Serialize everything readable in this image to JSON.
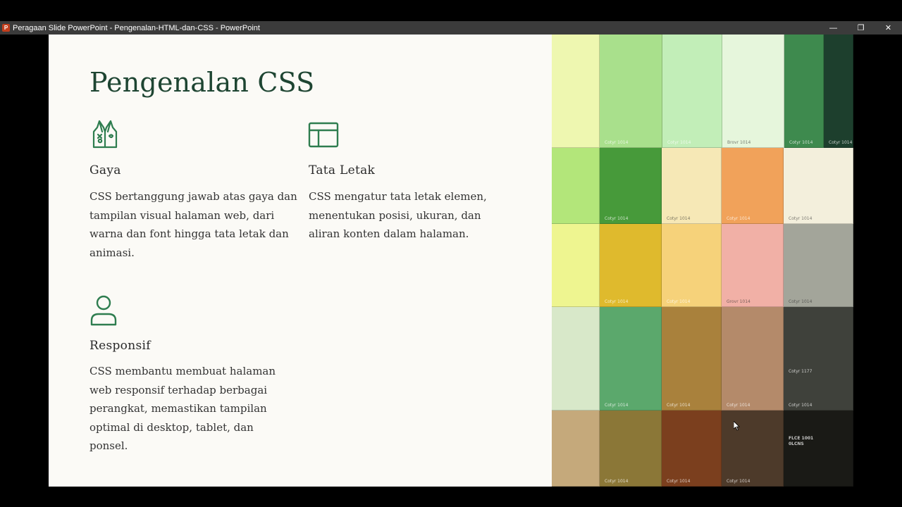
{
  "window": {
    "title": "Peragaan Slide PowerPoint  -  Pengenalan-HTML-dan-CSS - PowerPoint",
    "app_icon": "powerpoint-icon",
    "app_icon_letter": "P",
    "controls": {
      "minimize": "—",
      "restore": "❐",
      "close": "✕"
    }
  },
  "slide": {
    "title": "Pengenalan CSS",
    "title_color": "#1e4532",
    "accent_color": "#2e7d4f",
    "features": [
      {
        "icon": "vest-icon",
        "heading": "Gaya",
        "body": "CSS bertanggung jawab atas gaya dan tampilan visual halaman web, dari warna dan font hingga tata letak dan animasi."
      },
      {
        "icon": "layout-icon",
        "heading": "Tata Letak",
        "body": "CSS mengatur tata letak elemen, menentukan posisi, ukuran, dan aliran konten dalam halaman."
      },
      {
        "icon": "user-icon",
        "heading": "Responsif",
        "body": "CSS membantu membuat halaman web responsif terhadap berbagai perangkat, memastikan tampilan optimal di desktop, tablet, dan ponsel."
      }
    ],
    "swatch_image": {
      "description_icon": "color-swatch-image",
      "labels": [
        "Cotyr 1014",
        "Cotyr 1014",
        "Brovr 1014",
        "Cotyr 1014",
        "Cotyr 1014",
        "Cotyr 1014",
        "Cotyr 1014",
        "Cotyr 1014",
        "Cotyr 1014",
        "Cotyr 1014",
        "Cotyr 1014",
        "Grovr 1014",
        "Cotyr 1014",
        "Cotyr 1014",
        "Cotyr 1014",
        "Cotyr 1014",
        "Cotyr 1014",
        "Cotyr 1177",
        "Cotyr 1014",
        "Cotyr 1014",
        "Cotyr 1014",
        "FLCE",
        "1001 0LCNS"
      ],
      "colors": [
        "#eef7b0",
        "#a9e08c",
        "#c2eeb8",
        "#e6f6dc",
        "#3e8a4e",
        "#1d3f2d",
        "#b3e67a",
        "#479a3a",
        "#f6e8b6",
        "#f1a25a",
        "#f3efdc",
        "#eef590",
        "#dfba2d",
        "#f6d27a",
        "#f1b0a6",
        "#a3a59a",
        "#d8e8c9",
        "#5ba86c",
        "#a9813c",
        "#b48a6a",
        "#3f413b",
        "#c5a97b",
        "#8b7737",
        "#7b3f1e",
        "#4d3a2a",
        "#1a1a16"
      ]
    }
  }
}
